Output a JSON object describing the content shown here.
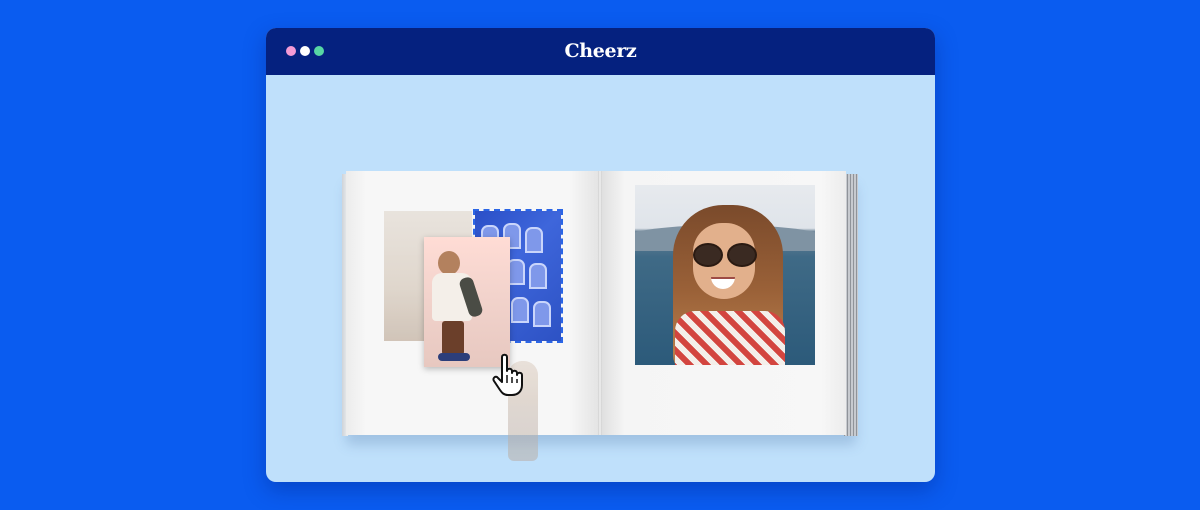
{
  "window": {
    "title": "Cheerz",
    "traffic_lights": [
      "pink-dot",
      "white-dot",
      "green-dot"
    ]
  },
  "colors": {
    "background": "#0a5cf0",
    "titlebar": "#05217f",
    "window_body": "#bfe0fb",
    "selection_outline": "#2b66e6"
  },
  "book": {
    "left_page": {
      "photos": [
        "kid-photo-faded",
        "kid-photo-dragged",
        "leaning-tower-photo-selected"
      ]
    },
    "right_page": {
      "photos": [
        "woman-portrait-photo"
      ]
    },
    "cursor": "hand-pointer-icon"
  }
}
